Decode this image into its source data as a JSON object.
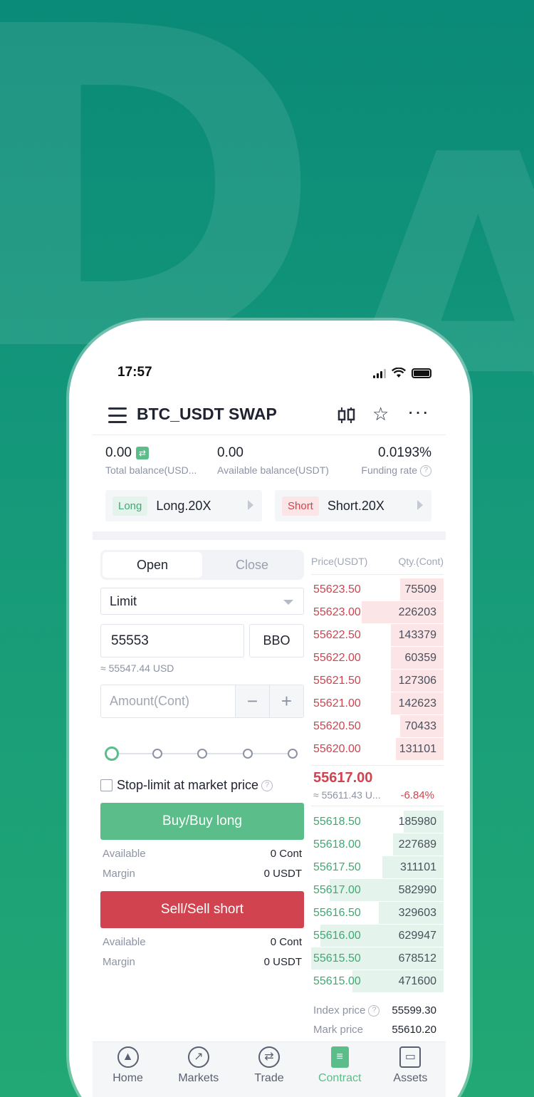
{
  "status": {
    "time": "17:57"
  },
  "header": {
    "title": "BTC_USDT SWAP"
  },
  "balances": {
    "total_value": "0.00",
    "total_label": "Total balance(USD...",
    "available_value": "0.00",
    "available_label": "Available balance(USDT)",
    "funding_value": "0.0193%",
    "funding_label": "Funding rate"
  },
  "leverage": {
    "long_tag": "Long",
    "long_value": "Long.20X",
    "short_tag": "Short",
    "short_value": "Short.20X"
  },
  "order": {
    "tabs": [
      "Open",
      "Close"
    ],
    "type": "Limit",
    "price": "55553",
    "bbo": "BBO",
    "approx": "≈ 55547.44 USD",
    "amount_placeholder": "Amount(Cont)",
    "minus": "−",
    "plus": "+",
    "stoplimit": "Stop-limit at market price",
    "buy_label": "Buy/Buy long",
    "sell_label": "Sell/Sell short",
    "buy_info": {
      "available_k": "Available",
      "available_v": "0 Cont",
      "margin_k": "Margin",
      "margin_v": "0 USDT"
    },
    "sell_info": {
      "available_k": "Available",
      "available_v": "0 Cont",
      "margin_k": "Margin",
      "margin_v": "0 USDT"
    },
    "slider_position": 0
  },
  "orderbook": {
    "price_header": "Price(USDT)",
    "qty_header": "Qty.(Cont)",
    "asks": [
      {
        "price": "55623.50",
        "qty": "75509",
        "depth": 0.33
      },
      {
        "price": "55623.00",
        "qty": "226203",
        "depth": 0.62
      },
      {
        "price": "55622.50",
        "qty": "143379",
        "depth": 0.4
      },
      {
        "price": "55622.00",
        "qty": "60359",
        "depth": 0.4
      },
      {
        "price": "55621.50",
        "qty": "127306",
        "depth": 0.4
      },
      {
        "price": "55621.00",
        "qty": "142623",
        "depth": 0.4
      },
      {
        "price": "55620.50",
        "qty": "70433",
        "depth": 0.33
      },
      {
        "price": "55620.00",
        "qty": "131101",
        "depth": 0.36
      }
    ],
    "last_price": "55617.00",
    "last_approx": "≈ 55611.43 U...",
    "last_change": "-6.84%",
    "bids": [
      {
        "price": "55618.50",
        "qty": "185980",
        "depth": 0.3
      },
      {
        "price": "55618.00",
        "qty": "227689",
        "depth": 0.38
      },
      {
        "price": "55617.50",
        "qty": "311101",
        "depth": 0.46
      },
      {
        "price": "55617.00",
        "qty": "582990",
        "depth": 0.86
      },
      {
        "price": "55616.50",
        "qty": "329603",
        "depth": 0.49
      },
      {
        "price": "55616.00",
        "qty": "629947",
        "depth": 0.93
      },
      {
        "price": "55615.50",
        "qty": "678512",
        "depth": 1.0
      },
      {
        "price": "55615.00",
        "qty": "471600",
        "depth": 0.69
      }
    ],
    "index_label": "Index price",
    "index_value": "55599.30",
    "mark_label": "Mark price",
    "mark_value": "55610.20"
  },
  "tabbar": [
    {
      "label": "Home",
      "icon": "home-icon",
      "glyph": "▲"
    },
    {
      "label": "Markets",
      "icon": "markets-icon",
      "glyph": "↗"
    },
    {
      "label": "Trade",
      "icon": "trade-icon",
      "glyph": "⇄"
    },
    {
      "label": "Contract",
      "icon": "contract-icon",
      "glyph": "≡",
      "active": true
    },
    {
      "label": "Assets",
      "icon": "assets-icon",
      "glyph": "▭"
    }
  ],
  "colors": {
    "green": "#5bbd8a",
    "red": "#d0434f",
    "bg_top": "#0a8a78",
    "bg_bottom": "#22a874"
  }
}
